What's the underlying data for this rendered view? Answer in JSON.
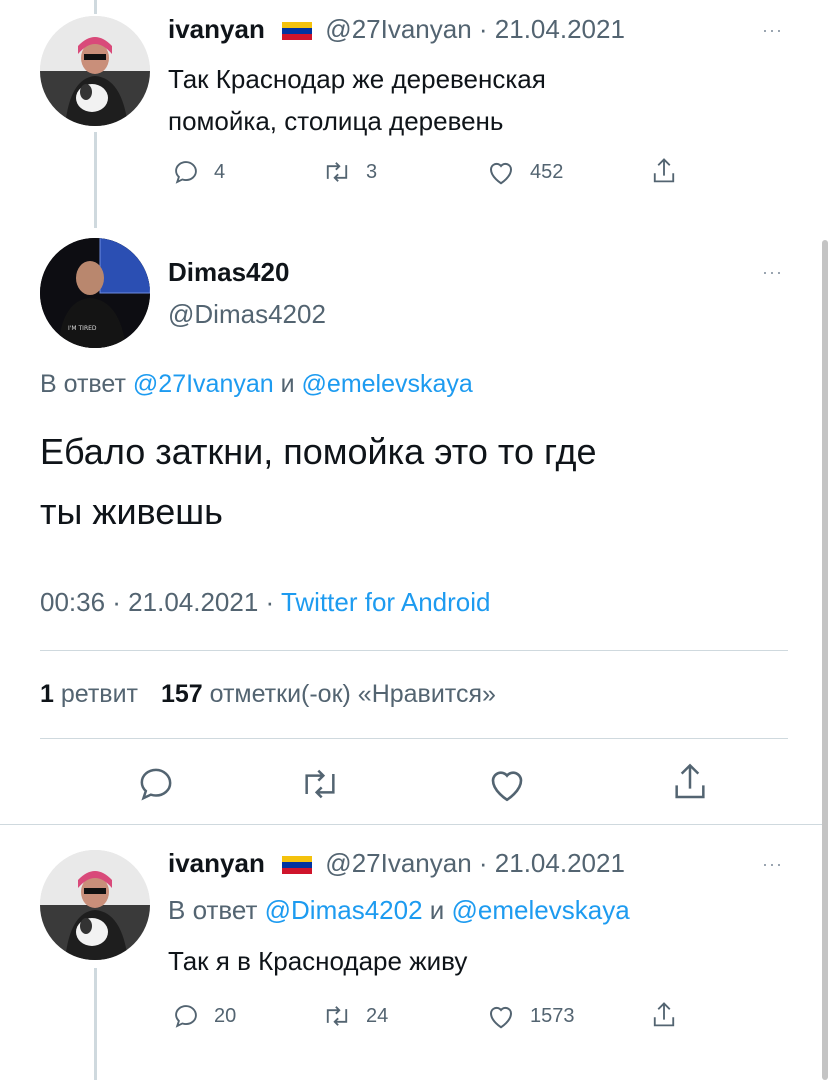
{
  "tweet1": {
    "display_name": "ivanyan",
    "meta": "@27Ivanyan · 21.04.2021",
    "text_line1": "Так Краснодар же деревенская",
    "text_line2": "помойка, столица деревень",
    "replies": "4",
    "retweets": "3",
    "likes": "452"
  },
  "main_tweet": {
    "display_name": "Dimas420",
    "handle": "@Dimas4202",
    "reply_prefix": "В ответ",
    "reply_user1": "@27Ivanyan",
    "reply_and": "и",
    "reply_user2": "@emelevskaya",
    "text_line1": "Ебало заткни, помойка это то где",
    "text_line2": "ты живешь",
    "time_date": "00:36 · 21.04.2021 · ",
    "source": "Twitter for Android",
    "retweet_count": "1",
    "retweet_label": "ретвит",
    "like_count": "157",
    "like_label": "отметки(-ок) «Нравится»"
  },
  "tweet3": {
    "display_name": "ivanyan",
    "meta": "@27Ivanyan · 21.04.2021",
    "reply_prefix": "В ответ",
    "reply_user1": "@Dimas4202",
    "reply_and": "и",
    "reply_user2": "@emelevskaya",
    "text": "Так я в Краснодаре живу",
    "replies": "20",
    "retweets": "24",
    "likes": "1573"
  },
  "icons": [
    "reply-icon",
    "retweet-icon",
    "like-icon",
    "share-icon",
    "more-icon",
    "flag-icon"
  ],
  "colors": {
    "link": "#1d9bf0",
    "muted": "#536471",
    "text": "#0f1419",
    "line": "#cfd9de"
  }
}
